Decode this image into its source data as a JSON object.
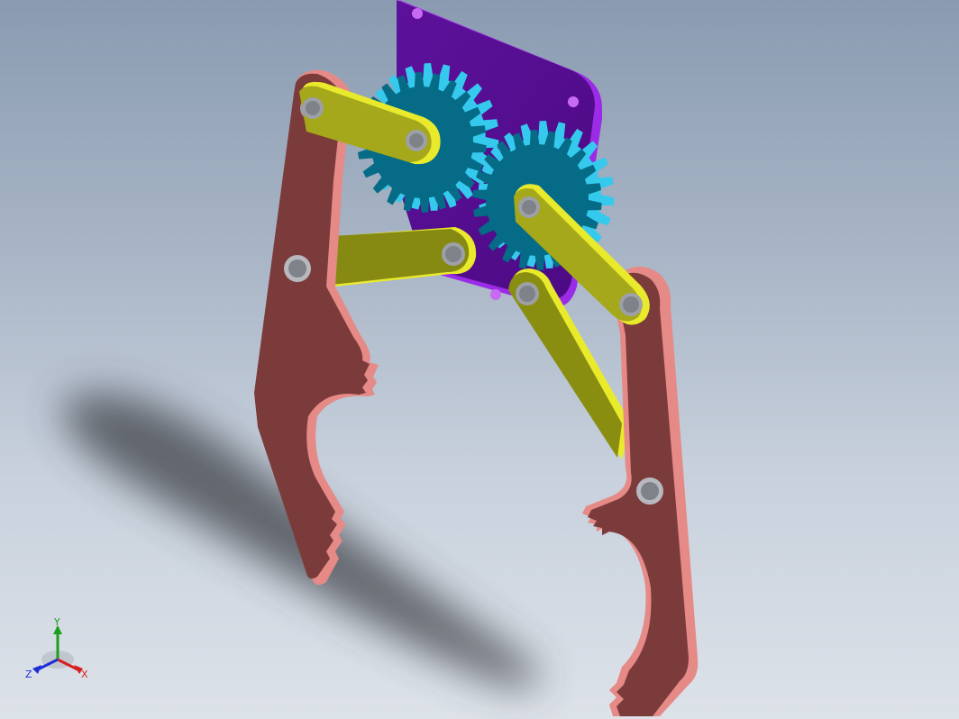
{
  "viewport": {
    "background_top": "#8a9bb1",
    "background_bottom": "#dde2e9"
  },
  "model": {
    "parts": [
      {
        "name": "base-plate",
        "color": "#5a0f96"
      },
      {
        "name": "spur-gear-left",
        "color": "#056b86",
        "tooth_color": "#35c9ee"
      },
      {
        "name": "spur-gear-right",
        "color": "#056b86",
        "tooth_color": "#35c9ee"
      },
      {
        "name": "gripper-jaw-left",
        "color": "#7e3c3c",
        "edge_color": "#e58a86"
      },
      {
        "name": "gripper-jaw-right",
        "color": "#7e3c3c",
        "edge_color": "#e58a86"
      },
      {
        "name": "link-bars",
        "color": "#9aa21b",
        "edge_color": "#e7ea2a"
      }
    ]
  },
  "triad": {
    "y_label": "Y",
    "x_label": "X",
    "z_label": "Z",
    "x_color": "#d81e1e",
    "y_color": "#1aa01a",
    "z_color": "#1e2ed8"
  }
}
